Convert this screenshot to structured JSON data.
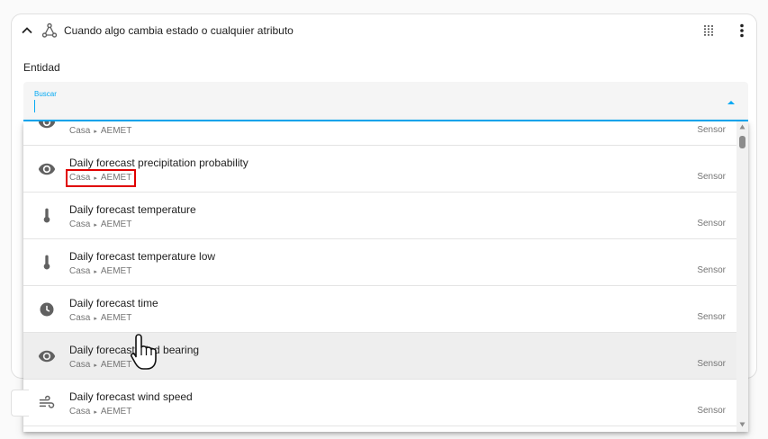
{
  "card": {
    "title": "Cuando algo cambia estado o cualquier atributo"
  },
  "field_label": "Entidad",
  "search": {
    "label": "Buscar",
    "value": ""
  },
  "entities": [
    {
      "icon": "eye-icon",
      "name": "",
      "area": "Casa",
      "integration": "AEMET",
      "kind": "Sensor"
    },
    {
      "icon": "eye-icon",
      "name": "Daily forecast precipitation probability",
      "area": "Casa",
      "integration": "AEMET",
      "kind": "Sensor"
    },
    {
      "icon": "thermometer-icon",
      "name": "Daily forecast temperature",
      "area": "Casa",
      "integration": "AEMET",
      "kind": "Sensor"
    },
    {
      "icon": "thermometer-icon",
      "name": "Daily forecast temperature low",
      "area": "Casa",
      "integration": "AEMET",
      "kind": "Sensor"
    },
    {
      "icon": "clock-icon",
      "name": "Daily forecast time",
      "area": "Casa",
      "integration": "AEMET",
      "kind": "Sensor"
    },
    {
      "icon": "eye-icon",
      "name": "Daily forecast wind bearing",
      "area": "Casa",
      "integration": "AEMET",
      "kind": "Sensor"
    },
    {
      "icon": "wind-icon",
      "name": "Daily forecast wind speed",
      "area": "Casa",
      "integration": "AEMET",
      "kind": "Sensor"
    }
  ],
  "separator": "▸",
  "colors": {
    "accent": "#03a9f4",
    "highlight_box": "#e00000",
    "icon": "#616161"
  }
}
